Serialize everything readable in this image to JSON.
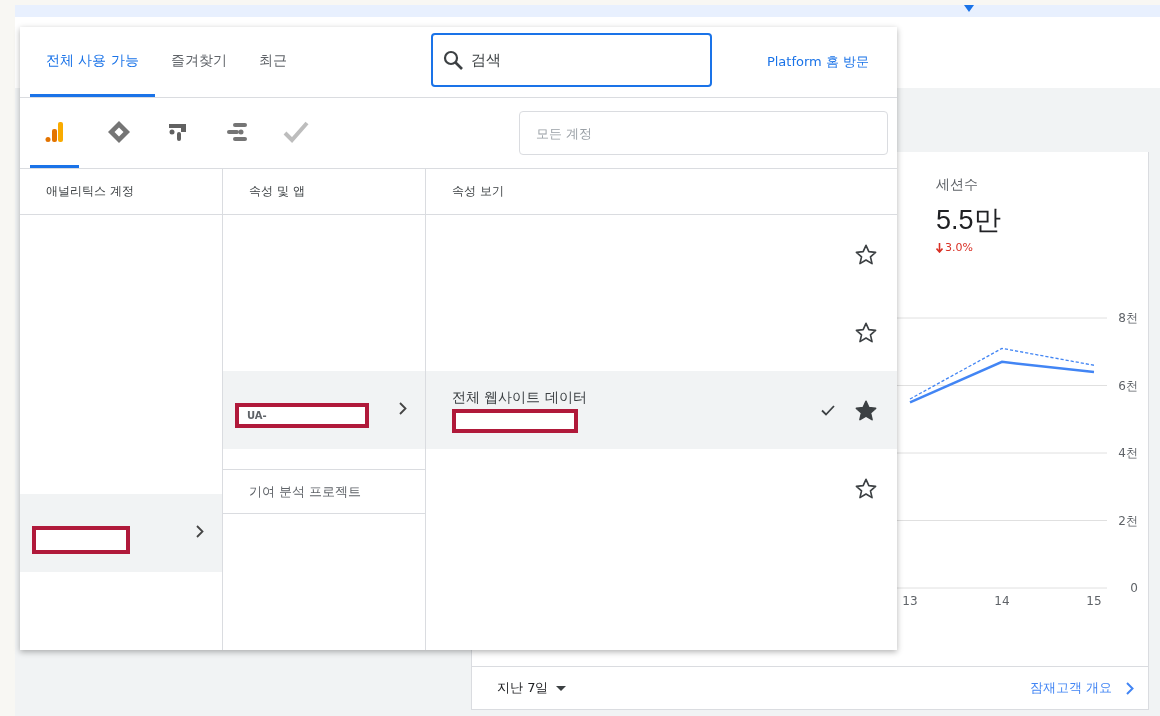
{
  "picker": {
    "tabs": [
      {
        "label": "전체 사용 가능",
        "selected": true
      },
      {
        "label": "즐겨찾기",
        "selected": false
      },
      {
        "label": "최근",
        "selected": false
      }
    ],
    "search": {
      "placeholder": "검색"
    },
    "platform_link": "Platform 홈 방문",
    "products": [
      {
        "kind": "analytics",
        "selected": true
      },
      {
        "kind": "tag-manager",
        "selected": false
      },
      {
        "kind": "optimize",
        "selected": false
      },
      {
        "kind": "data-studio",
        "selected": false
      },
      {
        "kind": "surveys",
        "selected": false
      }
    ],
    "account_filter": {
      "placeholder": "모든 계정"
    },
    "accounts": {
      "heading": "애널리틱스 계정",
      "items": [
        {
          "redacted": true,
          "selected": true
        }
      ]
    },
    "properties": {
      "heading": "속성 및 앱",
      "items": [
        {
          "label": "UA-",
          "redacted": true,
          "selected": true
        }
      ],
      "project": "기여 분석 프로젝트"
    },
    "views": {
      "heading": "속성 보기",
      "items": [
        {
          "selected": false,
          "starred": false
        },
        {
          "selected": false,
          "starred": false
        },
        {
          "name": "전체 웹사이트 데이터",
          "redacted": true,
          "checked": true,
          "selected": true,
          "starred": true
        },
        {
          "selected": false,
          "starred": false
        }
      ]
    }
  },
  "dashboard": {
    "metric": {
      "label": "세션수",
      "value": "5.5만",
      "change": "3.0%"
    },
    "chart_data": {
      "type": "line",
      "categories": [
        "13",
        "14",
        "15"
      ],
      "grid": true,
      "series": [
        {
          "color": "#4285f4",
          "line_style": "solid",
          "values": [
            5.5,
            6.7,
            6.4
          ]
        },
        {
          "color": "#4285f4",
          "line_style": "dashed",
          "values": [
            5.6,
            7.1,
            6.6
          ]
        }
      ],
      "ylim": [
        0,
        8
      ],
      "yticks": [
        {
          "value": 0,
          "label": "0"
        },
        {
          "value": 2,
          "label": "2천"
        },
        {
          "value": 4,
          "label": "4천"
        },
        {
          "value": 6,
          "label": "6천"
        },
        {
          "value": 8,
          "label": "8천"
        }
      ]
    },
    "footer": {
      "range": "지난 7일",
      "link": "잠재고객 개요"
    }
  }
}
